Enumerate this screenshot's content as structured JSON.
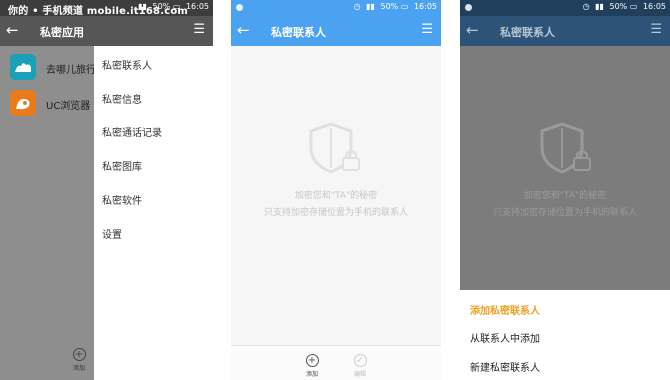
{
  "watermark": "你的 • 手机频道 mobile.it168.com",
  "status": {
    "battery": "50%",
    "time": "16:05",
    "icons": [
      "alarm-icon",
      "wifi-icon",
      "signal-icon",
      "battery-icon"
    ]
  },
  "screen1": {
    "title": "私密应用",
    "apps": [
      {
        "name": "去哪儿旅行",
        "icon": "qunar-camel-icon",
        "color": "#1aa0b8"
      },
      {
        "name": "UC浏览器",
        "icon": "uc-squirrel-icon",
        "color": "#e87b1e"
      }
    ],
    "drawer": [
      "私密联系人",
      "私密信息",
      "私密通话记录",
      "私密图库",
      "私密软件",
      "设置"
    ],
    "add_label": "添加"
  },
  "screen2": {
    "title": "私密联系人",
    "hint_line1": "加密您和\"TA\"的秘密",
    "hint_line2": "只支持加密存储位置为手机的联系人",
    "bottom_add": "添加",
    "bottom_edit": "编辑"
  },
  "screen3": {
    "title": "私密联系人",
    "hint_line1": "加密您和\"TA\"的秘密",
    "hint_line2": "只支持加密存储位置为手机的联系人",
    "sheet_title": "添加私密联系人",
    "sheet_items": [
      "从联系人中添加",
      "新建私密联系人"
    ]
  },
  "colors": {
    "blue_bar": "#4aa2f0",
    "accent_orange": "#f0a020",
    "dim_bar": "#2d5478"
  }
}
